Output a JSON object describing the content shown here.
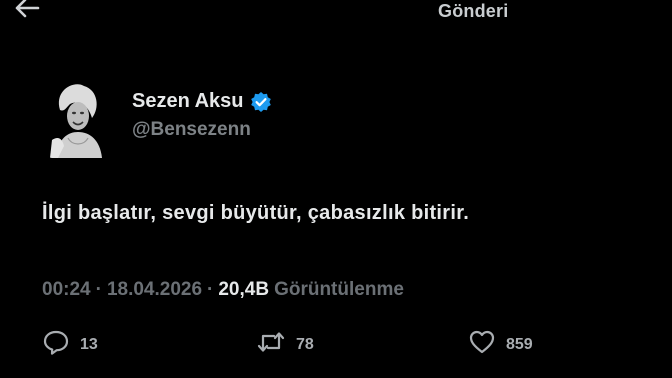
{
  "header": {
    "back_icon": "arrow-left-icon",
    "title": "Gönderi"
  },
  "author": {
    "display_name": "Sezen Aksu",
    "handle": "@Bensezenn",
    "verified": true,
    "verified_color": "#1d9bf0",
    "avatar_icon": "profile-photo"
  },
  "tweet": {
    "text": "İlgi başlatır, sevgi büyütür, çabasızlık bitirir.",
    "time": "00:24",
    "date": "18.04.2026",
    "separator": "·",
    "views_count": "20,4B",
    "views_label": "Görüntülenme"
  },
  "actions": {
    "replies": {
      "icon": "reply-icon",
      "count": "13"
    },
    "retweets": {
      "icon": "retweet-icon",
      "count": "78"
    },
    "likes": {
      "icon": "heart-icon",
      "count": "859"
    }
  },
  "colors": {
    "background": "#000000",
    "text_primary": "#e7e9ea",
    "text_muted": "#6b7075",
    "accent": "#1d9bf0"
  }
}
